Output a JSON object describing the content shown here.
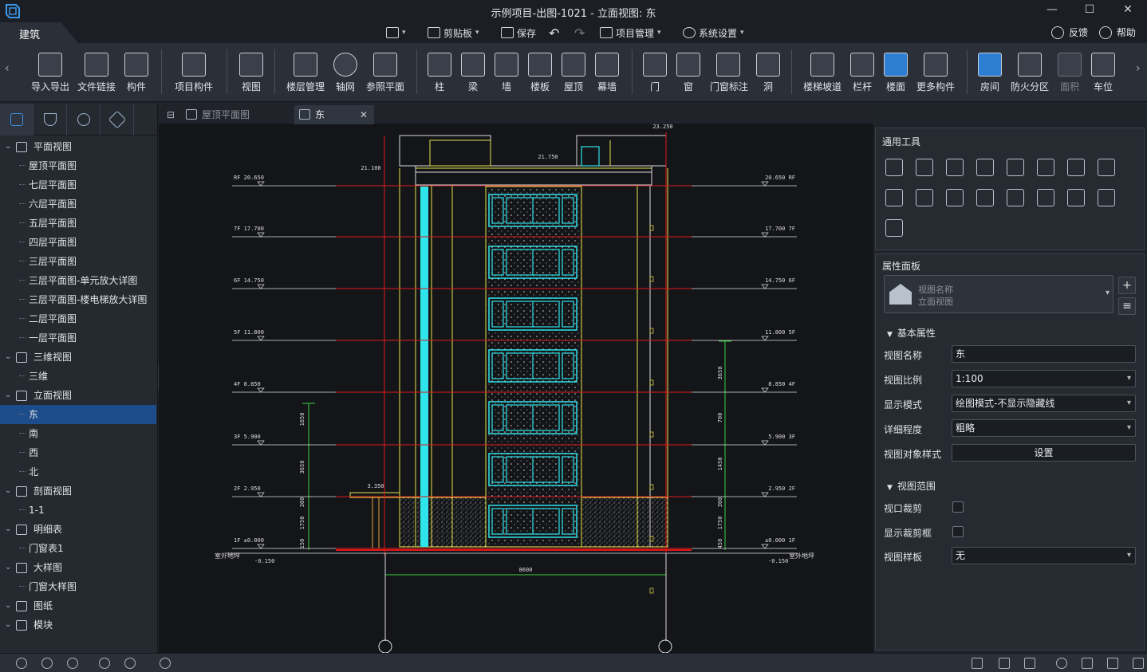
{
  "window": {
    "title": "示例项目-出图-1021 - 立面视图: 东",
    "buttons": [
      "—",
      "☐",
      "✕"
    ]
  },
  "menu": {
    "active_tab": "建筑",
    "quick_access": [
      {
        "icon": "folder-icon",
        "label": ""
      },
      {
        "icon": "clipboard-icon",
        "label": "剪贴板"
      },
      {
        "icon": "save-icon",
        "label": "保存"
      },
      {
        "icon": "undo-icon",
        "label": ""
      },
      {
        "icon": "redo-icon",
        "label": ""
      },
      {
        "icon": "project-manage-icon",
        "label": "项目管理"
      },
      {
        "icon": "settings-icon",
        "label": "系统设置"
      }
    ],
    "feedback": "反馈",
    "help": "帮助"
  },
  "ribbon": {
    "buttons": [
      {
        "icon": "cad-import-icon",
        "label": "导入导出"
      },
      {
        "icon": "file-link-icon",
        "label": "文件链接"
      },
      {
        "icon": "component-icon",
        "label": "构件"
      },
      {
        "icon": "project-component-icon",
        "label": "项目构件"
      },
      {
        "icon": "view-icon",
        "label": "视图"
      },
      {
        "icon": "floor-manage-icon",
        "label": "楼层管理"
      },
      {
        "icon": "axis-grid-icon",
        "label": "轴网"
      },
      {
        "icon": "ref-plane-icon",
        "label": "参照平面"
      },
      {
        "icon": "column-icon",
        "label": "柱"
      },
      {
        "icon": "beam-icon",
        "label": "梁"
      },
      {
        "icon": "wall-icon",
        "label": "墙"
      },
      {
        "icon": "slab-icon",
        "label": "楼板"
      },
      {
        "icon": "roof-icon",
        "label": "屋顶"
      },
      {
        "icon": "curtain-wall-icon",
        "label": "幕墙"
      },
      {
        "icon": "door-icon",
        "label": "门"
      },
      {
        "icon": "window-icon",
        "label": "窗"
      },
      {
        "icon": "door-window-tag-icon",
        "label": "门窗标注"
      },
      {
        "icon": "opening-icon",
        "label": "洞"
      },
      {
        "icon": "stair-ramp-icon",
        "label": "楼梯坡道"
      },
      {
        "icon": "railing-icon",
        "label": "栏杆"
      },
      {
        "icon": "floor-surface-icon",
        "label": "楼面"
      },
      {
        "icon": "more-components-icon",
        "label": "更多构件"
      },
      {
        "icon": "room-icon",
        "label": "房间"
      },
      {
        "icon": "fire-zone-icon",
        "label": "防火分区"
      },
      {
        "icon": "area-icon",
        "label": "面积"
      },
      {
        "icon": "parking-icon",
        "label": "车位"
      }
    ]
  },
  "tree": {
    "nodes": [
      {
        "label": "平面视图",
        "level": 0,
        "icon": "floor-plan-icon"
      },
      {
        "label": "屋顶平面图",
        "level": 1
      },
      {
        "label": "七层平面图",
        "level": 1
      },
      {
        "label": "六层平面图",
        "level": 1
      },
      {
        "label": "五层平面图",
        "level": 1
      },
      {
        "label": "四层平面图",
        "level": 1
      },
      {
        "label": "三层平面图",
        "level": 1
      },
      {
        "label": "三层平面图-单元放大详图",
        "level": 1
      },
      {
        "label": "三层平面图-楼电梯放大详图",
        "level": 1
      },
      {
        "label": "二层平面图",
        "level": 1
      },
      {
        "label": "一层平面图",
        "level": 1
      },
      {
        "label": "三维视图",
        "level": 0,
        "icon": "3d-view-icon"
      },
      {
        "label": "三维",
        "level": 1
      },
      {
        "label": "立面视图",
        "level": 0,
        "icon": "elevation-icon"
      },
      {
        "label": "东",
        "level": 1,
        "selected": true
      },
      {
        "label": "南",
        "level": 1
      },
      {
        "label": "西",
        "level": 1
      },
      {
        "label": "北",
        "level": 1
      },
      {
        "label": "剖面视图",
        "level": 0,
        "icon": "section-icon"
      },
      {
        "label": "1-1",
        "level": 1
      },
      {
        "label": "明细表",
        "level": 0,
        "icon": "schedule-icon"
      },
      {
        "label": "门窗表1",
        "level": 1
      },
      {
        "label": "大样图",
        "level": 0,
        "icon": "detail-icon"
      },
      {
        "label": "门窗大样图",
        "level": 1
      },
      {
        "label": "图纸",
        "level": 0,
        "icon": "sheet-icon"
      },
      {
        "label": "模块",
        "level": 0,
        "icon": "module-icon"
      }
    ]
  },
  "doc_tabs": [
    {
      "label": "屋顶平面图",
      "active": false
    },
    {
      "label": "东",
      "active": true
    }
  ],
  "drawing": {
    "levels_left": [
      {
        "label": "RF 20.650"
      },
      {
        "label": "7F 17.700"
      },
      {
        "label": "6F 14.750"
      },
      {
        "label": "5F 11.800"
      },
      {
        "label": "4F 8.850"
      },
      {
        "label": "3F 5.900"
      },
      {
        "label": "2F 2.950"
      },
      {
        "label": "1F ±0.000"
      }
    ],
    "levels_right": [
      {
        "label": "20.650 RF"
      },
      {
        "label": "17.700 7F"
      },
      {
        "label": "14.750 6F"
      },
      {
        "label": "11.800 5F"
      },
      {
        "label": "8.850 4F"
      },
      {
        "label": "5.900 3F"
      },
      {
        "label": "2.950 2F"
      },
      {
        "label": "±0.000 1F"
      }
    ],
    "top_elevations": [
      "23.250",
      "21.750",
      "21.100"
    ],
    "entry_elevation": "3.350",
    "ground_left": "室外地坪",
    "ground_right": "室外地坪",
    "ground_value_left": "-0.150",
    "ground_value_right": "-0.150",
    "total_width": "8600",
    "left_dims": [
      "1650",
      "3650",
      "300",
      "1750",
      "150"
    ],
    "right_dims": [
      "3650",
      "700",
      "1450",
      "300",
      "1750",
      "450"
    ]
  },
  "tools_panel": {
    "title": "通用工具",
    "icons": [
      "move-icon",
      "copy-icon",
      "rotate-icon",
      "align-icon",
      "offset-icon",
      "split-icon",
      "trim-icon",
      "extend-icon",
      "join-icon",
      "break-icon",
      "array-icon",
      "group-icon",
      "mirror-icon",
      "stretch-icon",
      "delete-icon",
      "batch-icon",
      "measure-icon"
    ]
  },
  "properties": {
    "title": "属性面板",
    "view_type_name_label": "视图名称",
    "view_type_value": "立面视图",
    "basic_section": "基本属性",
    "rows": [
      {
        "label": "视图名称",
        "value": "东",
        "type": "text"
      },
      {
        "label": "视图比例",
        "value": "1:100",
        "type": "select"
      },
      {
        "label": "显示模式",
        "value": "绘图模式-不显示隐藏线",
        "type": "select"
      },
      {
        "label": "详细程度",
        "value": "粗略",
        "type": "select"
      },
      {
        "label": "视图对象样式",
        "value": "设置",
        "type": "button"
      }
    ],
    "range_section": "视图范围",
    "range_rows": [
      {
        "label": "视口裁剪",
        "type": "checkbox",
        "checked": false
      },
      {
        "label": "显示裁剪框",
        "type": "checkbox",
        "checked": false
      },
      {
        "label": "视图样板",
        "value": "无",
        "type": "select"
      }
    ]
  },
  "colors": {
    "accent": "#1d4c8a",
    "cad_red": "#e0191c",
    "cad_yellow": "#e8e34a",
    "cad_cyan": "#2fe4ea",
    "cad_green": "#36d43a"
  }
}
